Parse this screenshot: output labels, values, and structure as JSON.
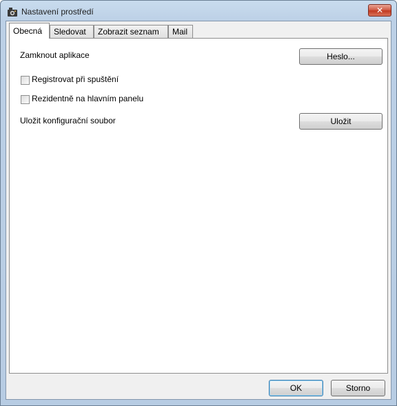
{
  "window": {
    "title": "Nastavení prostředí",
    "close_glyph": "✕"
  },
  "tabs": [
    {
      "label": "Obecná",
      "active": true
    },
    {
      "label": "Sledovat",
      "active": false
    },
    {
      "label": "Zobrazit seznam",
      "active": false
    },
    {
      "label": "Mail",
      "active": false
    }
  ],
  "general": {
    "lock_label": "Zamknout aplikace",
    "password_button": "Heslo...",
    "register_startup_label": "Registrovat při spuštění",
    "register_startup_checked": false,
    "resident_taskbar_label": "Rezidentně na hlavním panelu",
    "resident_taskbar_checked": false,
    "save_config_label": "Uložit konfigurační soubor",
    "save_button": "Uložit"
  },
  "footer": {
    "ok_button": "OK",
    "cancel_button": "Storno"
  },
  "icons": {
    "app": "camera-icon",
    "close": "close-icon"
  }
}
